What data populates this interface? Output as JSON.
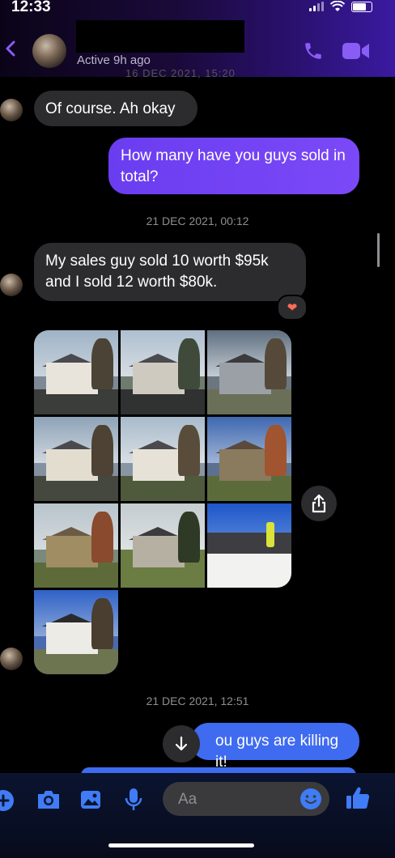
{
  "status_bar": {
    "time": "12:33"
  },
  "header": {
    "active_status": "Active 9h ago",
    "peek_timestamp": "16 DEC 2021, 15:20"
  },
  "messages": [
    {
      "id": "m1",
      "direction": "incoming",
      "text": "Of course. Ah okay"
    },
    {
      "id": "m2",
      "direction": "outgoing",
      "text": "How many have you guys sold in total?"
    },
    {
      "id": "ts1",
      "type": "timestamp",
      "text": "21 DEC 2021, 00:12"
    },
    {
      "id": "m3",
      "direction": "incoming",
      "text": "My sales guy sold 10 worth $95k and I sold 12 worth $80k.",
      "reaction": "heart"
    },
    {
      "id": "m4",
      "direction": "incoming",
      "type": "photo_grid",
      "photo_count": 10
    },
    {
      "id": "ts2",
      "type": "timestamp",
      "text": "21 DEC 2021, 12:51"
    },
    {
      "id": "m5",
      "direction": "outgoing",
      "text": "ou guys are killing it!"
    }
  ],
  "composer": {
    "placeholder": "Aa"
  },
  "icons": [
    "back-chevron-icon",
    "phone-icon",
    "video-icon",
    "share-icon",
    "scroll-down-icon",
    "plus-icon",
    "camera-icon",
    "gallery-icon",
    "mic-icon",
    "emoji-icon",
    "like-icon"
  ],
  "colors": {
    "accent": "#7b49f7",
    "outgoing_blue": "#3f6bf0",
    "incoming_bubble": "#2c2c2e",
    "reaction_heart": "#ff6b57"
  }
}
